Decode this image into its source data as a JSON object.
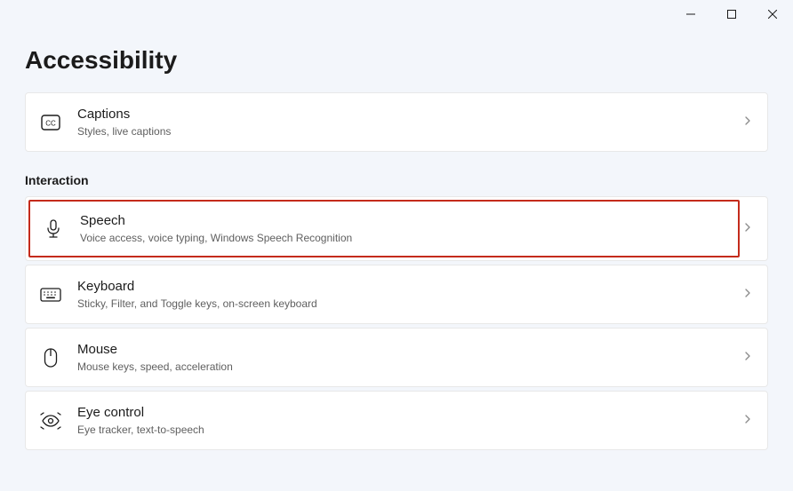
{
  "page": {
    "title": "Accessibility"
  },
  "sections": {
    "interaction_header": "Interaction"
  },
  "items": {
    "captions": {
      "title": "Captions",
      "desc": "Styles, live captions"
    },
    "speech": {
      "title": "Speech",
      "desc": "Voice access, voice typing, Windows Speech Recognition"
    },
    "keyboard": {
      "title": "Keyboard",
      "desc": "Sticky, Filter, and Toggle keys, on-screen keyboard"
    },
    "mouse": {
      "title": "Mouse",
      "desc": "Mouse keys, speed, acceleration"
    },
    "eyecontrol": {
      "title": "Eye control",
      "desc": "Eye tracker, text-to-speech"
    }
  }
}
